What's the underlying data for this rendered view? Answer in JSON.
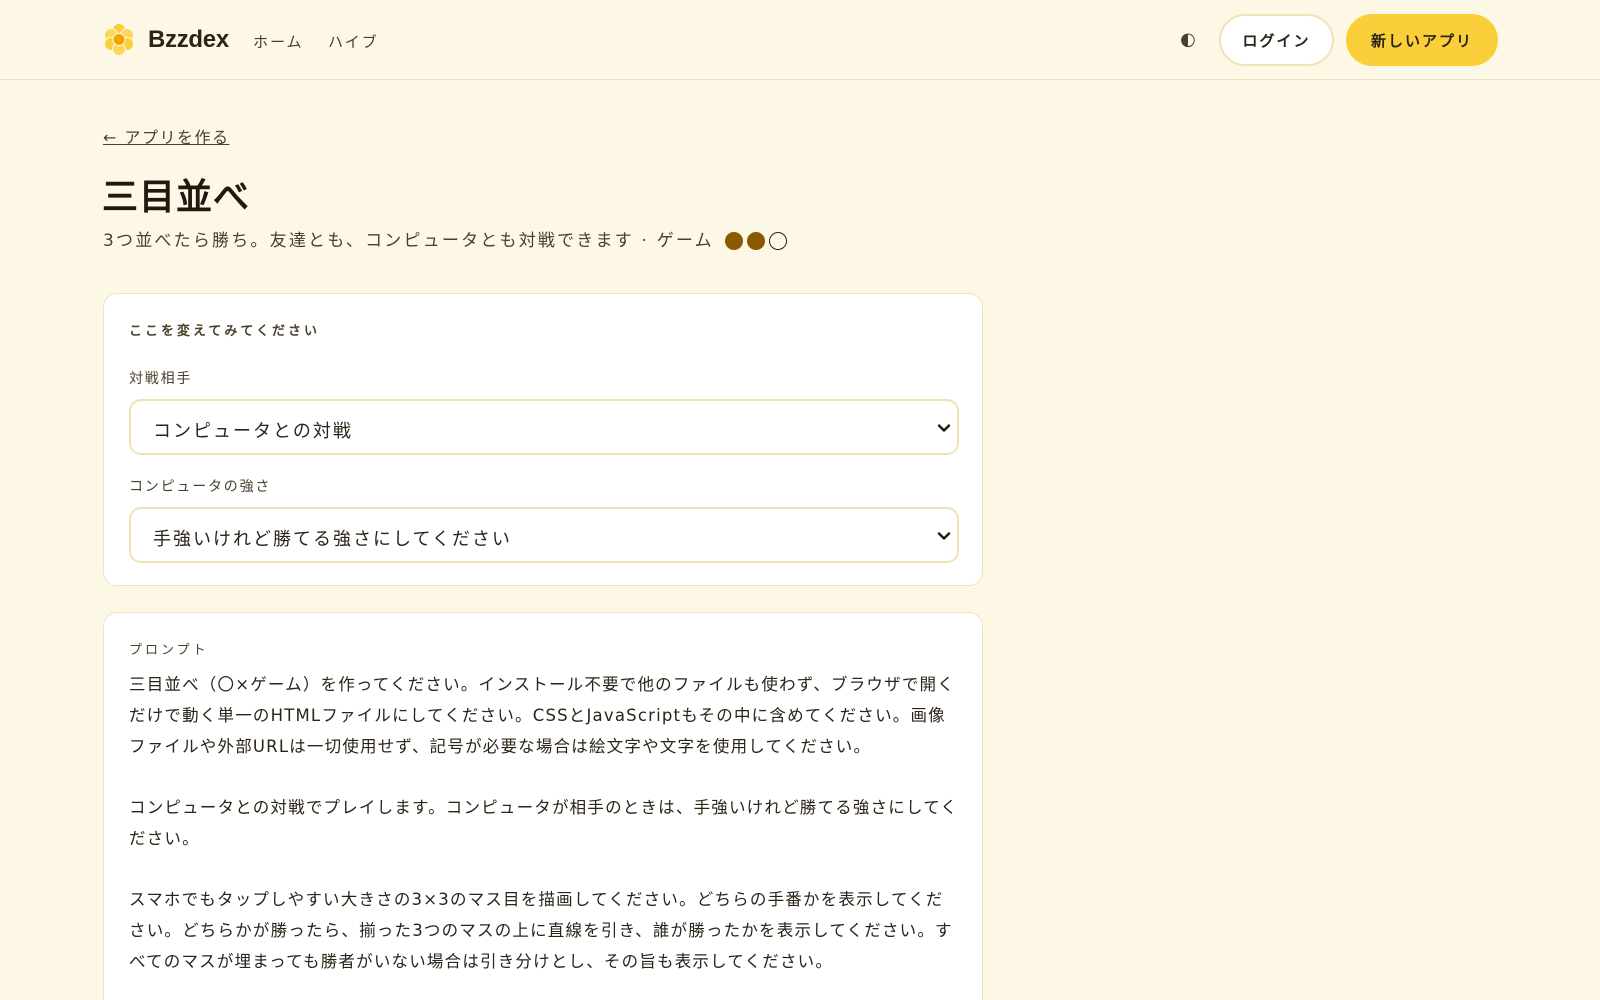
{
  "header": {
    "brand": "Bzzdex",
    "nav": {
      "home": "ホーム",
      "hive": "ハイブ"
    },
    "theme_toggle_glyph": "◐",
    "login_label": "ログイン",
    "new_app_label": "新しいアプリ"
  },
  "main": {
    "back_link": "← アプリを作る",
    "title": "三目並べ",
    "subtitle": "3つ並べたら勝ち。友達とも、コンピュータとも対戦できます · ゲーム",
    "difficulty": {
      "filled": 2,
      "total": 3
    },
    "options": {
      "heading": "ここを変えてみてください",
      "opponent_label": "対戦相手",
      "opponent_value": "コンピュータとの対戦",
      "strength_label": "コンピュータの強さ",
      "strength_value": "手強いけれど勝てる強さにしてください"
    },
    "prompt": {
      "heading": "プロンプト",
      "paragraphs": [
        "三目並べ（〇×ゲーム）を作ってください。インストール不要で他のファイルも使わず、ブラウザで開くだけで動く単一のHTMLファイルにしてください。CSSとJavaScriptもその中に含めてください。画像ファイルや外部URLは一切使用せず、記号が必要な場合は絵文字や文字を使用してください。",
        "コンピュータとの対戦でプレイします。コンピュータが相手のときは、手強いけれど勝てる強さにしてください。",
        "スマホでもタップしやすい大きさの3×3のマス目を描画してください。どちらの手番かを表示してください。どちらかが勝ったら、揃った3つのマスの上に直線を引き、誰が勝ったかを表示してください。すべてのマスが埋まっても勝者がいない場合は引き分けとし、その旨も表示してください。"
      ]
    }
  },
  "colors": {
    "background": "#fdf8e6",
    "accent": "#fbcf3a",
    "difficulty_dot": "#8a5a00",
    "card_border": "#ece3c6"
  }
}
